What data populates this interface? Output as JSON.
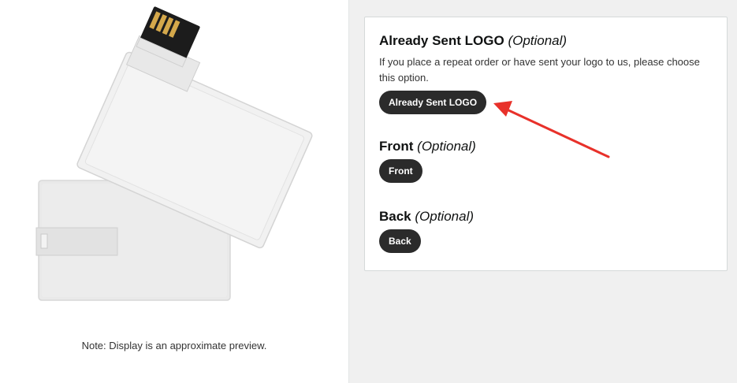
{
  "preview": {
    "note": "Note: Display is an approximate preview."
  },
  "options": [
    {
      "title": "Already Sent LOGO",
      "optional": "(Optional)",
      "description": "If you place a repeat order or have sent your logo to us, please choose this option.",
      "button_label": "Already Sent LOGO"
    },
    {
      "title": "Front",
      "optional": "(Optional)",
      "button_label": "Front"
    },
    {
      "title": "Back",
      "optional": "(Optional)",
      "button_label": "Back"
    }
  ],
  "colors": {
    "button_bg": "#2b2b2b",
    "arrow": "#e8312a",
    "panel_bg": "#f0f0f0"
  }
}
